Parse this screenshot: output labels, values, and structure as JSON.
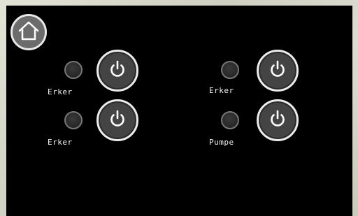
{
  "header": {
    "home_icon": "home-icon"
  },
  "switches": [
    {
      "label": "Erker",
      "icon": "power-icon",
      "state": "off"
    },
    {
      "label": "Erker",
      "icon": "power-icon",
      "state": "off"
    },
    {
      "label": "Erker",
      "icon": "power-icon",
      "state": "off"
    },
    {
      "label": "Pumpe",
      "icon": "power-icon",
      "state": "off"
    }
  ],
  "colors": {
    "panel_bg": "#000000",
    "button_fill": "#444444",
    "button_ring": "#ebebeb",
    "home_fill": "#6c6c6c",
    "led_off": "#2a2a2a",
    "text": "#f0f0f0"
  }
}
